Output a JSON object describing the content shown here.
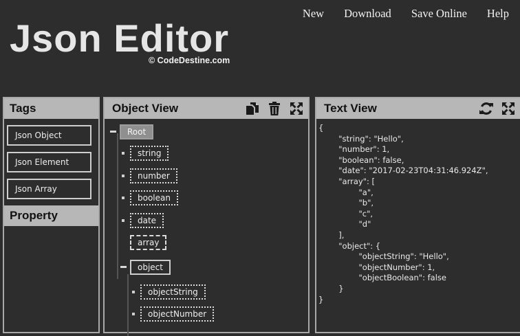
{
  "nav": {
    "items": [
      "New",
      "Download",
      "Save Online",
      "Help"
    ]
  },
  "brand": {
    "title": "Json Editor",
    "subtitle": "© CodeDestine.com"
  },
  "tags_panel": {
    "title": "Tags",
    "buttons": [
      "Json Object",
      "Json Element",
      "Json Array"
    ],
    "property_title": "Property"
  },
  "object_view": {
    "title": "Object View",
    "tools": [
      "copy-icon",
      "trash-icon",
      "expand-icon"
    ],
    "nodes": {
      "root": "Root",
      "string": "string",
      "number": "number",
      "boolean": "boolean",
      "date": "date",
      "array": "array",
      "object": "object",
      "objectString": "objectString",
      "objectNumber": "objectNumber"
    }
  },
  "text_view": {
    "title": "Text View",
    "tools": [
      "refresh-icon",
      "expand-icon"
    ],
    "content": "{\n        \"string\": \"Hello\",\n        \"number\": 1,\n        \"boolean\": false,\n        \"date\": \"2017-02-23T04:31:46.924Z\",\n        \"array\": [\n                \"a\",\n                \"b\",\n                \"c\",\n                \"d\"\n        ],\n        \"object\": {\n                \"objectString\": \"Hello\",\n                \"objectNumber\": 1,\n                \"objectBoolean\": false\n        }\n}"
  }
}
